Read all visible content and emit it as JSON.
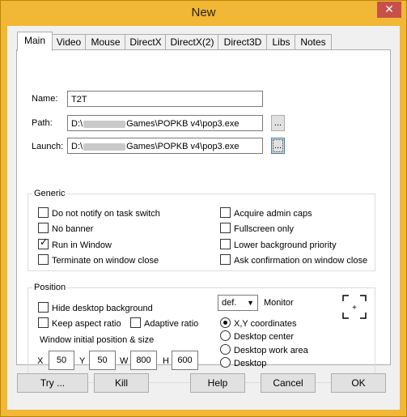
{
  "window": {
    "title": "New",
    "close_glyph": "✕"
  },
  "tabs": [
    {
      "label": "Main",
      "active": true
    },
    {
      "label": "Video"
    },
    {
      "label": "Mouse"
    },
    {
      "label": "DirectX"
    },
    {
      "label": "DirectX(2)"
    },
    {
      "label": "Direct3D"
    },
    {
      "label": "Libs"
    },
    {
      "label": "Notes"
    }
  ],
  "fields": {
    "name_label": "Name:",
    "name_value": "T2T",
    "path_label": "Path:",
    "path_prefix": "D:\\",
    "path_suffix": "Games\\POPKB v4\\pop3.exe",
    "launch_label": "Launch:",
    "launch_prefix": "D:\\",
    "launch_suffix": "Games\\POPKB v4\\pop3.exe",
    "browse_label": "..."
  },
  "generic": {
    "title": "Generic",
    "options": [
      {
        "label": "Do not notify on task switch",
        "checked": false
      },
      {
        "label": "No banner",
        "checked": false
      },
      {
        "label": "Run in Window",
        "checked": true
      },
      {
        "label": "Terminate on window close",
        "checked": false
      },
      {
        "label": "Acquire admin caps",
        "checked": false
      },
      {
        "label": "Fullscreen only",
        "checked": false
      },
      {
        "label": "Lower background priority",
        "checked": false
      },
      {
        "label": "Ask confirmation on window close",
        "checked": false
      }
    ]
  },
  "position": {
    "title": "Position",
    "hide_desktop": "Hide desktop background",
    "keep_aspect": "Keep aspect ratio",
    "adaptive": "Adaptive ratio",
    "monitor_value": "def.",
    "monitor_label": "Monitor",
    "initial_label": "Window initial position & size",
    "x_label": "X",
    "x_value": "50",
    "y_label": "Y",
    "y_value": "50",
    "w_label": "W",
    "w_value": "800",
    "h_label": "H",
    "h_value": "600",
    "radios": [
      {
        "label": "X,Y coordinates",
        "selected": true
      },
      {
        "label": "Desktop center",
        "selected": false
      },
      {
        "label": "Desktop work area",
        "selected": false
      },
      {
        "label": "Desktop",
        "selected": false
      }
    ],
    "bracket_glyph": "+"
  },
  "buttons": {
    "try": "Try ...",
    "kill": "Kill",
    "help": "Help",
    "cancel": "Cancel",
    "ok": "OK"
  }
}
